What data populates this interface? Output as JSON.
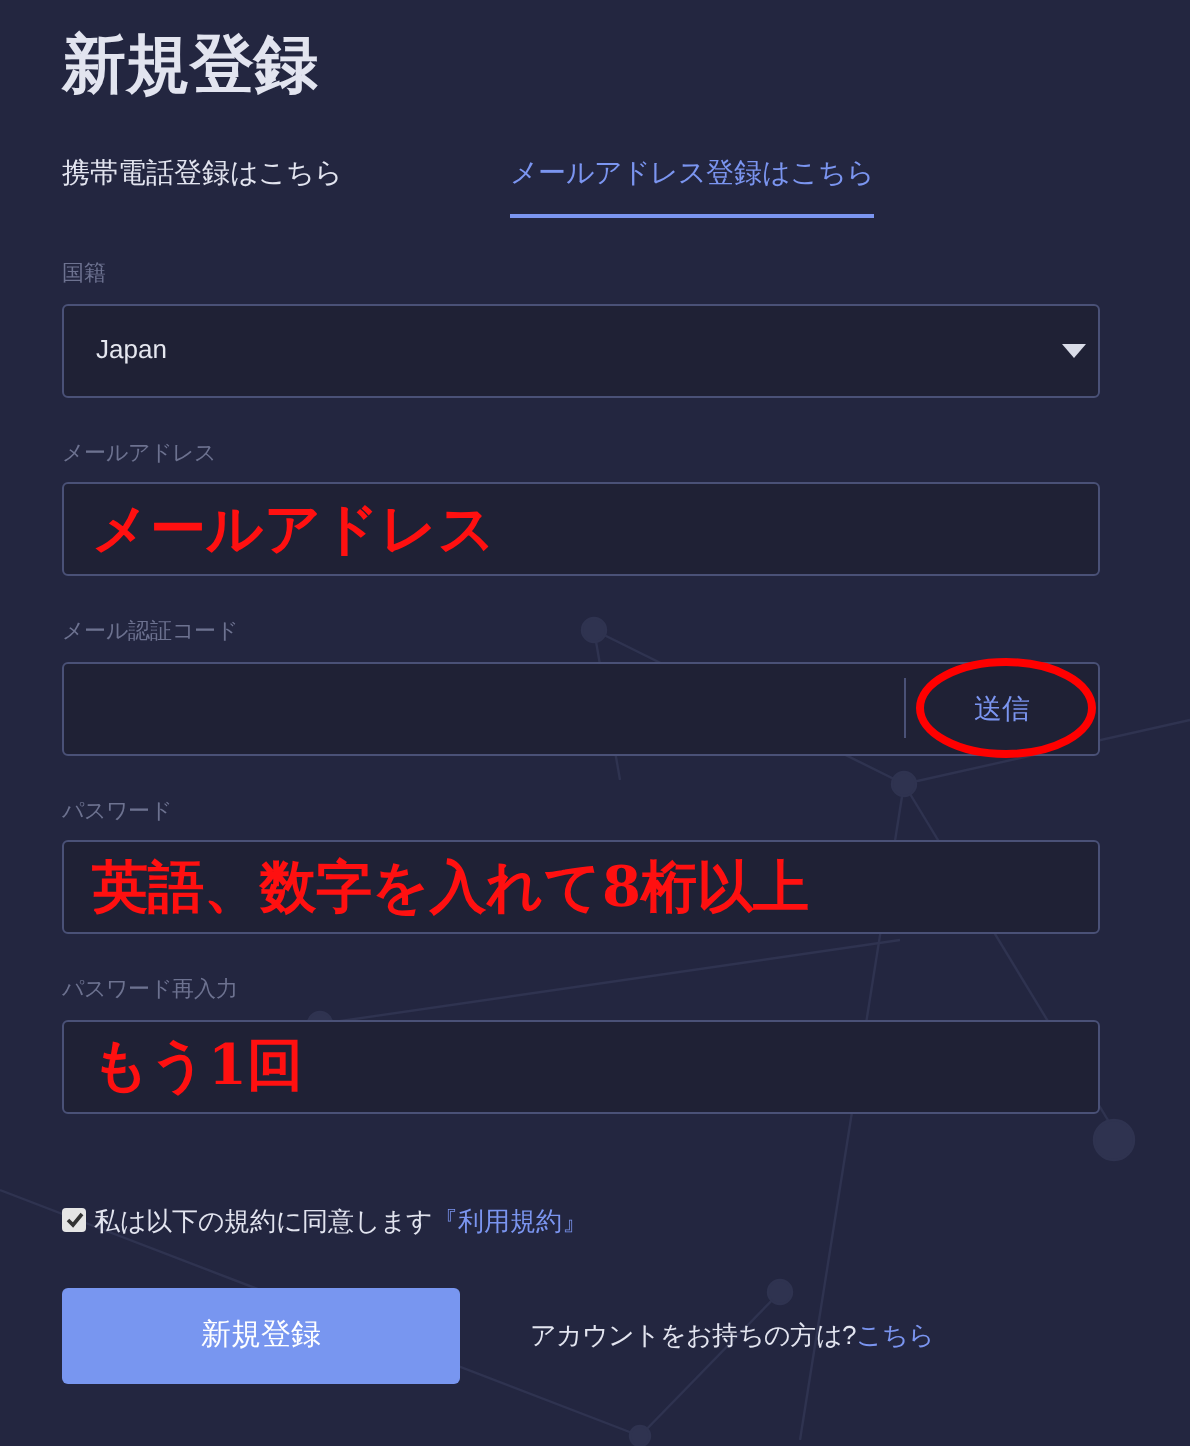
{
  "title": "新規登録",
  "tabs": [
    {
      "label": "携帯電話登録はこちら",
      "selected": false
    },
    {
      "label": "メールアドレス登録はこちら",
      "selected": true
    }
  ],
  "fields": [
    {
      "kind": "select",
      "label": "国籍",
      "value": "Japan"
    },
    {
      "kind": "text",
      "label": "メールアドレス",
      "value": "メールアドレス",
      "annotated": true
    },
    {
      "kind": "code",
      "label": "メール認証コード",
      "button": {
        "label": "送信",
        "circled": true
      }
    },
    {
      "kind": "text",
      "label": "パスワード",
      "value": "英語、数字を入れて8桁以上",
      "annotated": true
    },
    {
      "kind": "text",
      "label": "パスワード再入力",
      "value": "もう1回",
      "annotated": true
    }
  ],
  "agreement": {
    "checked": true,
    "text": "私は以下の規約に同意します",
    "link": "『利用規約』"
  },
  "submit": "新規登録",
  "login": {
    "text": "アカウントをお持ちの方は?",
    "link": "こちら"
  }
}
